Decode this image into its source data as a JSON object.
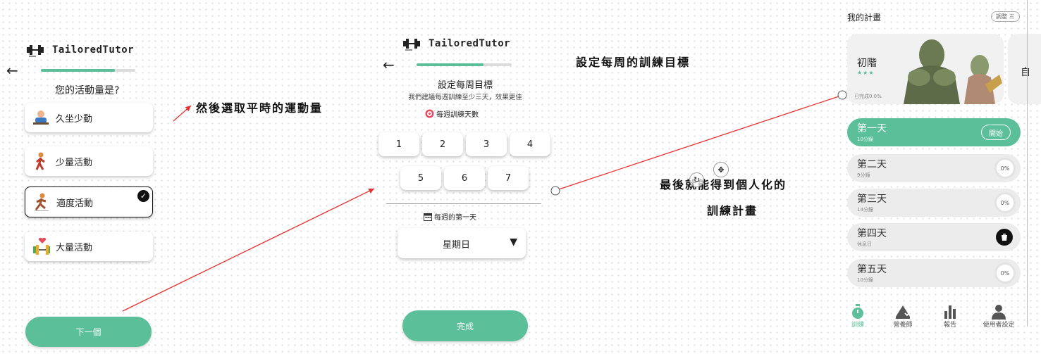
{
  "brand": {
    "name": "TailoredTutor",
    "accent": "#5bbf99",
    "arrow_color": "#e8312f"
  },
  "screen1": {
    "back_icon": "arrow-left-icon",
    "progress_fraction": 0.78,
    "question": "您的活動量是?",
    "options": [
      {
        "label": "久坐少動",
        "icon": "desk-person-icon",
        "selected": false
      },
      {
        "label": "少量活動",
        "icon": "walking-person-icon",
        "selected": false
      },
      {
        "label": "適度活動",
        "icon": "running-person-icon",
        "selected": true
      },
      {
        "label": "大量活動",
        "icon": "heart-dumbbell-icon",
        "selected": false
      }
    ],
    "next_button": "下一個"
  },
  "screen2": {
    "back_icon": "arrow-left-icon",
    "progress_fraction": 0.7,
    "title": "設定每周目標",
    "subtitle": "我們建議每週訓練至少三天，效果更佳",
    "days_label": "每週訓練天數",
    "days": [
      "1",
      "2",
      "3",
      "4",
      "5",
      "6",
      "7"
    ],
    "first_day_label": "每週的第一天",
    "first_day_value": "星期日",
    "done_button": "完成"
  },
  "screen3": {
    "header_title": "我的計畫",
    "adjust_button": "調整 三",
    "level_card": {
      "title": "初階",
      "stars": "★★★",
      "completed": "已完成0.0%"
    },
    "next_card_title": "自",
    "days": [
      {
        "title": "第一天",
        "sub": "10分鐘",
        "action": "開始",
        "active": true
      },
      {
        "title": "第二天",
        "sub": "9分鐘",
        "pct": "0%"
      },
      {
        "title": "第三天",
        "sub": "14分鐘",
        "pct": "0%"
      },
      {
        "title": "第四天",
        "sub": "休息日",
        "icon": "cup-icon"
      },
      {
        "title": "第五天",
        "sub": "10分鐘",
        "pct": "0%"
      }
    ],
    "nav": [
      {
        "label": "訓練",
        "icon": "stopwatch-icon",
        "active": true
      },
      {
        "label": "營養師",
        "icon": "scale-icon"
      },
      {
        "label": "報告",
        "icon": "bar-chart-icon"
      },
      {
        "label": "使用者設定",
        "icon": "user-icon"
      }
    ]
  },
  "annotations": {
    "step1": "然後選取平時的運動量",
    "step2": "設定每周的訓練目標",
    "step3_line1": "最後就能得到個人化的",
    "step3_line2": "訓練計畫"
  }
}
